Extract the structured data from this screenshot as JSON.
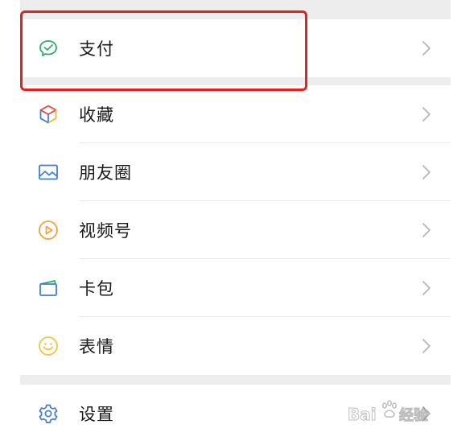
{
  "menu": {
    "items": [
      {
        "label": "支付",
        "icon": "wechat-pay-icon"
      },
      {
        "label": "收藏",
        "icon": "favorites-cube-icon"
      },
      {
        "label": "朋友圈",
        "icon": "moments-picture-icon"
      },
      {
        "label": "视频号",
        "icon": "channels-play-icon"
      },
      {
        "label": "卡包",
        "icon": "card-wallet-icon"
      },
      {
        "label": "表情",
        "icon": "sticker-smile-icon"
      },
      {
        "label": "设置",
        "icon": "settings-gear-icon"
      }
    ]
  },
  "watermark": {
    "text": "Bai经验"
  },
  "colors": {
    "highlight_border": "#e8201a",
    "section_gap": "#ededed",
    "pay_green": "#2aae67",
    "settings_blue": "#3d7fd6",
    "channels_orange": "#f2a23a",
    "sticker_yellow": "#f5c242"
  }
}
